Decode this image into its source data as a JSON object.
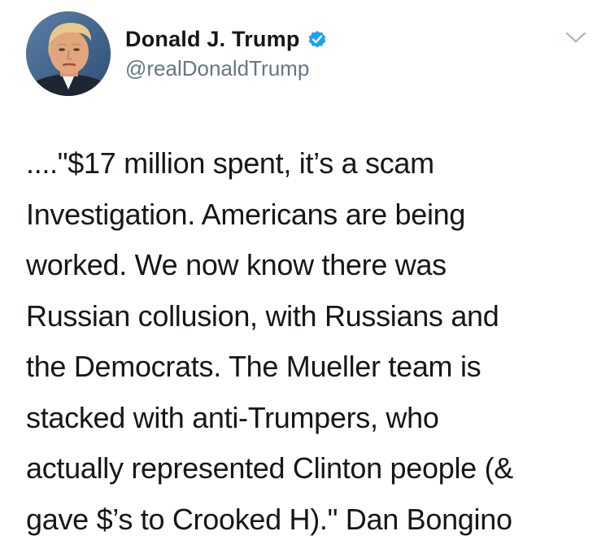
{
  "tweet": {
    "author": {
      "display_name": "Donald J. Trump",
      "handle": "@realDonaldTrump",
      "verified": true,
      "avatar_icon": "profile-photo",
      "verified_icon": "verified-badge-icon"
    },
    "menu_icon": "chevron-down-icon",
    "text": "....\"$17 million spent, it’s a scam\nInvestigation. Americans are being\nworked. We now know there was\nRussian collusion, with Russians and\nthe Democrats. The Mueller team is\nstacked with anti-Trumpers, who\nactually represented Clinton people (&\ngave $’s to Crooked H).\" Dan Bongino"
  },
  "colors": {
    "text": "#14171a",
    "secondary": "#657786",
    "verified_blue": "#1da1f2",
    "caret": "#aab8c2"
  }
}
